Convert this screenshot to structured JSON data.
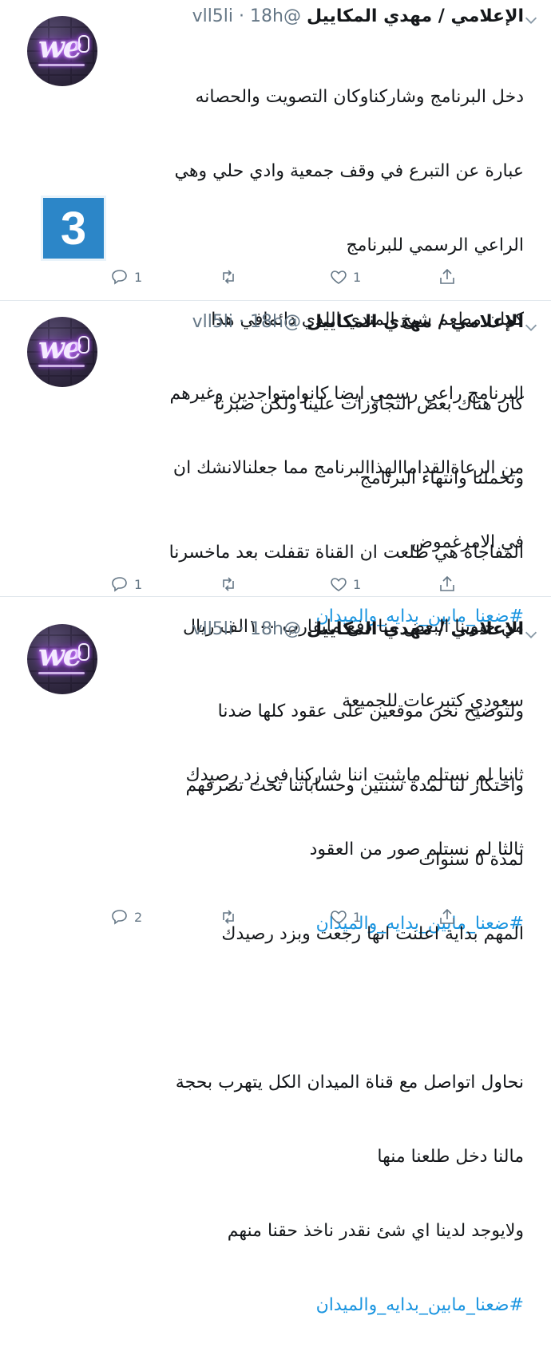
{
  "tweets": [
    {
      "name": "الإعلامي / مهدي المكاييل",
      "meta": "@vll5li · 18h",
      "lines": [
        "دخل البرنامج وشاركناوكان التصويت والحصانه",
        "عبارة عن التبرع في وقف جمعية وادي حلي وهي",
        "الراعي الرسمي للبرنامج",
        "كمان مطعم شيخ المندي اللذي دائمافي هذا",
        "البرنامج راعي رسمي ايضا كانوامتواجدين وغيرهم",
        "من الرعاةالقداماالهذاالبرنامج مما جعلنالانشك ان",
        "في الامرغموض"
      ],
      "hashtag": "#ضعنا_مابين_بدايه_والميدان",
      "replies": "1",
      "retweets": "",
      "likes": "1"
    },
    {
      "name": "الإعلامي / مهدي المكاييل",
      "meta": "@vll5li · 18h",
      "lines": [
        "كان هناك بعض التجاوزات علينا ولكن صبرنا",
        "وتحملنا وانتهاء البرنامج",
        "المفاجاة هي طلعت ان القناة تقفلت بعد ماخسرنا",
        "من جيوبنا البعض منا دفع مايقارب ١٠٠الف ريال",
        "سعودي كتبرعات للجميعة",
        "ثانيا لم نستلم مايثبت اننا شاركنا في زد رصيدك",
        "ثالثا لم نستلم صور من العقود"
      ],
      "hashtag": "#ضعنا_مابين_بدايه_والميدان",
      "replies": "1",
      "retweets": "",
      "likes": "1"
    },
    {
      "name": "الإعلامي / مهدي المكاييل",
      "meta": "@vll5li · 18h",
      "lines": [
        "ولتوضيح نحن موقعين على عقود كلها ضدنا",
        "واحتكار لنا لمدة سنتين وحساباتنا تحت تصرفهم",
        "لمدة ٥ سنوات",
        "المهم بداية اعلنت انها رجعت وبزد رصيدك",
        "",
        "نحاول اتواصل مع قناة الميدان الكل يتهرب بحجة",
        "مالنا دخل طلعنا منها",
        "ولايوجد لدينا اي شئ نقدر ناخذ حقنا منهم"
      ],
      "hashtag": "#ضعنا_مابين_بدايه_والميدان",
      "replies": "2",
      "retweets": "",
      "likes": "1"
    }
  ],
  "badge": {
    "number": "3",
    "color": "#2c86c8"
  },
  "colors": {
    "link": "#1b95e0",
    "muted": "#657786",
    "text": "#14171a"
  },
  "icons": [
    "reply-icon",
    "retweet-icon",
    "like-icon",
    "share-icon",
    "chevron-down-icon"
  ]
}
